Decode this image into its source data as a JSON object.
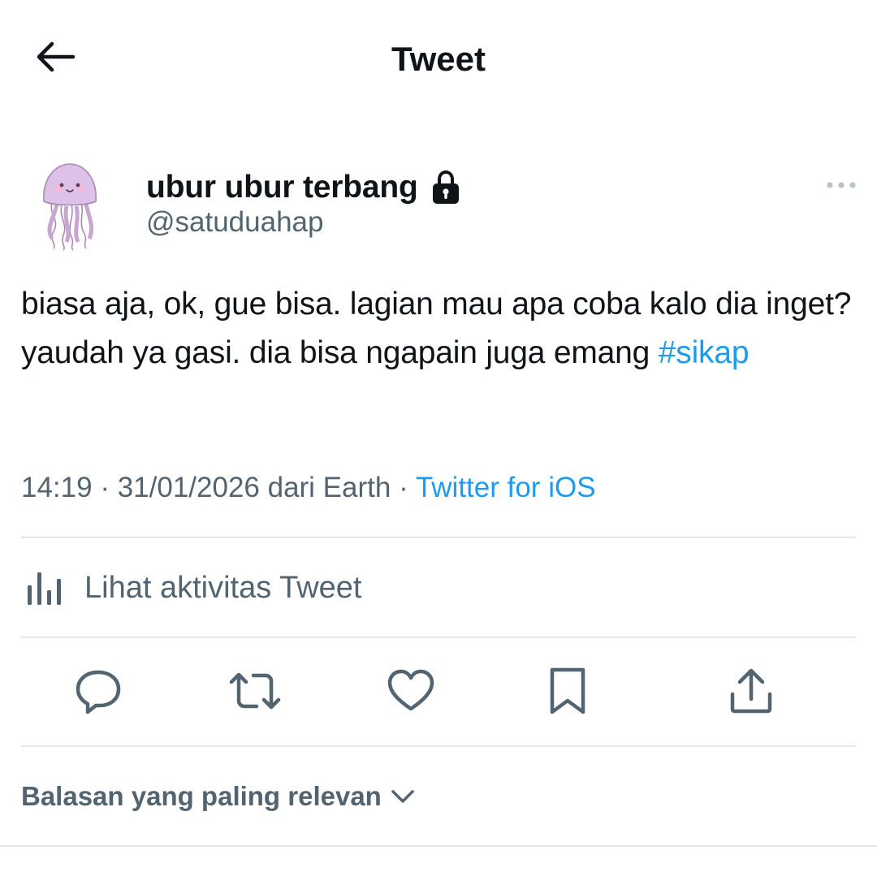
{
  "header": {
    "title": "Tweet",
    "back_icon": "back-arrow-icon"
  },
  "author": {
    "display_name": "ubur ubur terbang",
    "handle": "@satuduahap",
    "protected_icon": "lock-icon",
    "avatar": "jellyfish-avatar",
    "more_icon": "more-horizontal-icon"
  },
  "tweet": {
    "text": "biasa aja, ok, gue bisa. lagian mau apa coba kalo dia inget? yaudah ya gasi. dia bisa ngapain juga emang ",
    "hashtag": "#sikap"
  },
  "meta": {
    "time": "14:19",
    "sep1": " · ",
    "date": "31/01/2026",
    "location": " dari Earth",
    "sep2": " · ",
    "source": "Twitter for iOS"
  },
  "activity": {
    "label": "Lihat aktivitas Tweet",
    "icon": "analytics-icon"
  },
  "actions": [
    {
      "name": "reply",
      "icon": "reply-icon"
    },
    {
      "name": "retweet",
      "icon": "retweet-icon"
    },
    {
      "name": "like",
      "icon": "heart-icon"
    },
    {
      "name": "bookmark",
      "icon": "bookmark-icon"
    },
    {
      "name": "share",
      "icon": "share-icon"
    }
  ],
  "replies": {
    "sort_label": "Balasan yang paling relevan",
    "sort_icon": "chevron-down-icon"
  },
  "colors": {
    "text": "#0f1419",
    "secondary": "#536471",
    "accent": "#1d9bf0",
    "divider": "#e3e8ec"
  }
}
